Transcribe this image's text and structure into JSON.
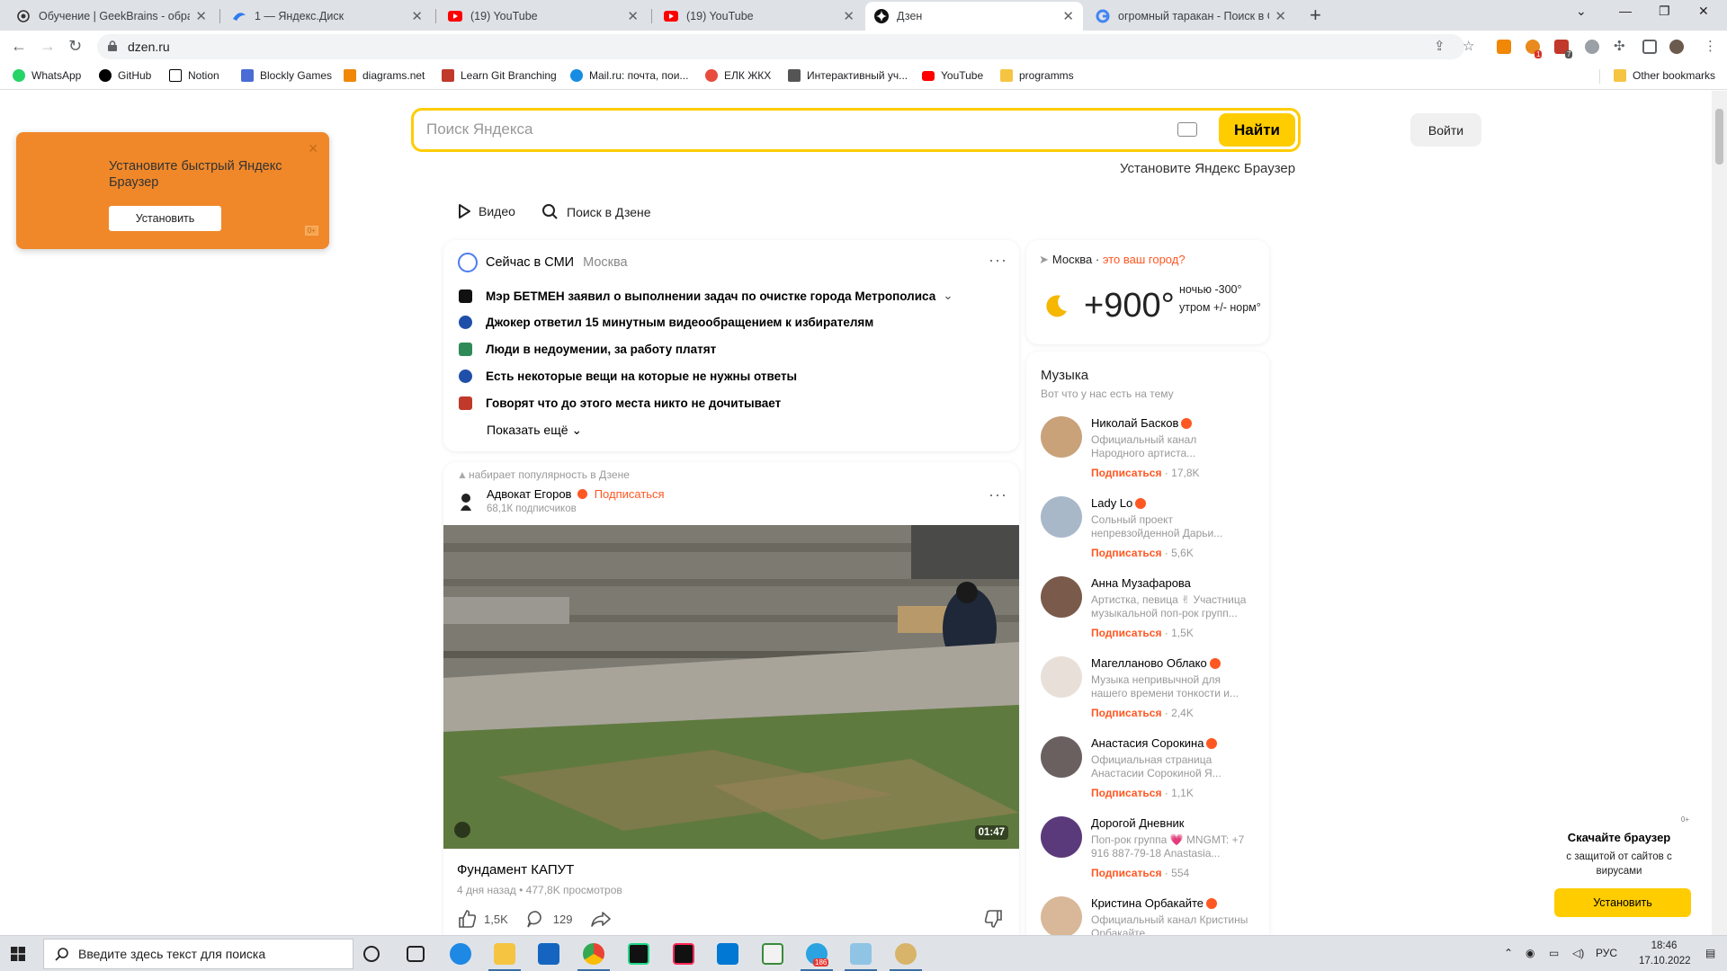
{
  "browser": {
    "tabs": [
      {
        "title": "Обучение | GeekBrains - образо",
        "icon": "geekbrains-icon"
      },
      {
        "title": "1 — Яндекс.Диск",
        "icon": "yandex-disk-icon"
      },
      {
        "title": "(19) YouTube",
        "icon": "youtube-icon"
      },
      {
        "title": "(19) YouTube",
        "icon": "youtube-icon"
      },
      {
        "title": "Дзен",
        "icon": "dzen-icon",
        "active": true
      },
      {
        "title": "огромный таракан - Поиск в Go",
        "icon": "google-icon"
      }
    ],
    "url": "dzen.ru",
    "extension_badges": [
      "1",
      "7"
    ]
  },
  "bookmarks": [
    {
      "label": "WhatsApp",
      "icon": "whatsapp-icon",
      "color": "#25d366"
    },
    {
      "label": "GitHub",
      "icon": "github-icon",
      "color": "#000000"
    },
    {
      "label": "Notion",
      "icon": "notion-icon",
      "color": "#000000"
    },
    {
      "label": "Blockly Games",
      "icon": "blockly-icon",
      "color": "#4a6cd4"
    },
    {
      "label": "diagrams.net",
      "icon": "diagrams-icon",
      "color": "#f08705"
    },
    {
      "label": "Learn Git Branching",
      "icon": "git-icon",
      "color": "#c0392b"
    },
    {
      "label": "Mail.ru: почта, пои...",
      "icon": "mailru-icon",
      "color": "#168de2"
    },
    {
      "label": "ЕЛК ЖКХ",
      "icon": "elk-icon",
      "color": "#e74c3c"
    },
    {
      "label": "Интерактивный уч...",
      "icon": "interactive-icon",
      "color": "#555555"
    },
    {
      "label": "YouTube",
      "icon": "youtube-icon",
      "color": "#ff0000"
    },
    {
      "label": "programms",
      "icon": "folder-icon",
      "color": "#f5c542"
    },
    {
      "label": "Other bookmarks",
      "icon": "folder-icon",
      "color": "#f5c542"
    }
  ],
  "promo": {
    "text": "Установите быстрый Яндекс Браузер",
    "button": "Установить",
    "age": "0+"
  },
  "search": {
    "placeholder": "Поиск Яндекса",
    "button": "Найти"
  },
  "login_button": "Войти",
  "install_link": "Установите Яндекс Браузер",
  "dzen_nav": {
    "video": "Видео",
    "search": "Поиск в Дзене"
  },
  "news": {
    "title": "Сейчас в СМИ",
    "city": "Москва",
    "items": [
      {
        "text": "Мэр БЕТМЕН заявил о выполнении задач по очистке города Метрополиса",
        "color": "#111111"
      },
      {
        "text": "Джокер ответил 15 минутным видеообращением к избирателям",
        "color": "#1f4fa8"
      },
      {
        "text": "Люди в недоумении, за работу платят",
        "color": "#2e8b57"
      },
      {
        "text": "Есть некоторые вещи на которые не нужны ответы",
        "color": "#1f4fa8"
      },
      {
        "text": "Говорят что до этого места никто не дочитывает",
        "color": "#c0392b"
      }
    ],
    "show_more": "Показать ещё"
  },
  "post": {
    "popular": "набирает популярность в Дзене",
    "author": "Адвокат Егоров",
    "subscribe": "Подписаться",
    "subscribers": "68,1К подписчиков",
    "duration": "01:47",
    "title": "Фундамент КАПУТ",
    "meta": "4 дня назад • 477,8K просмотров",
    "likes": "1,5K",
    "comments": "129"
  },
  "weather": {
    "location": "Москва",
    "question": "это ваш город?",
    "temp": "+900°",
    "condition": "ночью -300° утром +/- норм°"
  },
  "music": {
    "title": "Музыка",
    "subtitle": "Вот что у нас есть на тему",
    "subscribe": "Подписаться",
    "artists": [
      {
        "name": "Николай Басков",
        "desc": "Официальный канал Народного артиста...",
        "followers": "17,8K",
        "color": "#c9a27a"
      },
      {
        "name": "Lady Lo",
        "desc": "Сольный проект непревзойденной Дарьи...",
        "followers": "5,6K",
        "color": "#a8b8c8"
      },
      {
        "name": "Анна Музафарова",
        "desc": "Артистка, певица ✌ Участница музыкальной поп-рок групп...",
        "followers": "1,5K",
        "color": "#7a5a4a"
      },
      {
        "name": "Магелланово Облако",
        "desc": "Музыка непривычной для нашего времени тонкости и...",
        "followers": "2,4K",
        "color": "#e8e0d8"
      },
      {
        "name": "Анастасия Сорокина",
        "desc": "Официальная страница Анастасии Сорокиной Я...",
        "followers": "1,1K",
        "color": "#6a6060"
      },
      {
        "name": "Дорогой Дневник",
        "desc": "Поп-рок группа 💗 MNGMT: +7 916 887-79-18 Anastasia...",
        "followers": "554",
        "color": "#5a3a7a"
      },
      {
        "name": "Кристина Орбакайте",
        "desc": "Официальный канал Кристины Орбакайте",
        "followers": "",
        "color": "#d8b898"
      }
    ]
  },
  "download_promo": {
    "age": "0+",
    "title": "Скачайте браузер",
    "desc": "с защитой от сайтов с вирусами",
    "button": "Установить"
  },
  "taskbar": {
    "search_placeholder": "Введите здесь текст для поиска",
    "language": "РУС",
    "time": "18:46",
    "date": "17.10.2022",
    "telegram_badge": "186"
  }
}
